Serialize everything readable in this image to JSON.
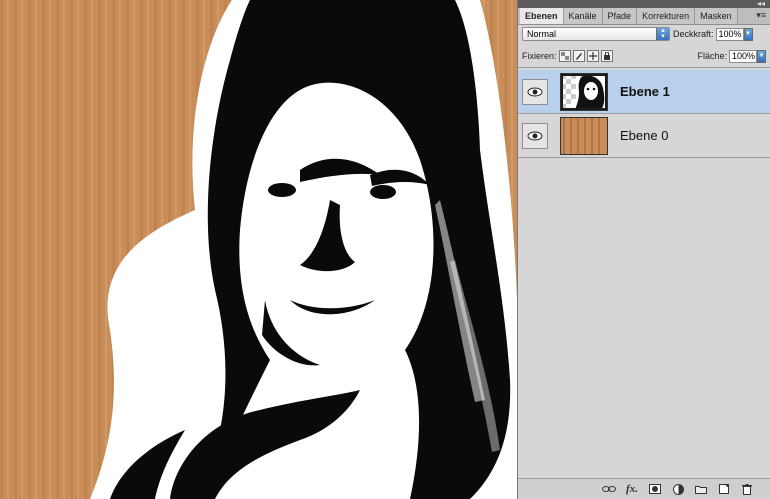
{
  "panel": {
    "tabs": [
      {
        "label": "Ebenen",
        "active": true
      },
      {
        "label": "Kanäle",
        "active": false
      },
      {
        "label": "Pfade",
        "active": false
      },
      {
        "label": "Korrekturen",
        "active": false
      },
      {
        "label": "Masken",
        "active": false
      }
    ],
    "blend_mode": "Normal",
    "opacity_label": "Deckkraft:",
    "opacity_value": "100%",
    "lock_label": "Fixieren:",
    "fill_label": "Fläche:",
    "fill_value": "100%",
    "layers": [
      {
        "name": "Ebene 1",
        "selected": true
      },
      {
        "name": "Ebene 0",
        "selected": false
      }
    ],
    "bottom_icons": [
      "link-icon",
      "fx-icon",
      "mask-icon",
      "adjustment-icon",
      "group-icon",
      "new-layer-icon",
      "trash-icon"
    ],
    "fx_label": "fx."
  },
  "colors": {
    "cardboard": "#c98d5a",
    "selection": "#b8d0ec",
    "panel_bg": "#d6d6d6"
  }
}
